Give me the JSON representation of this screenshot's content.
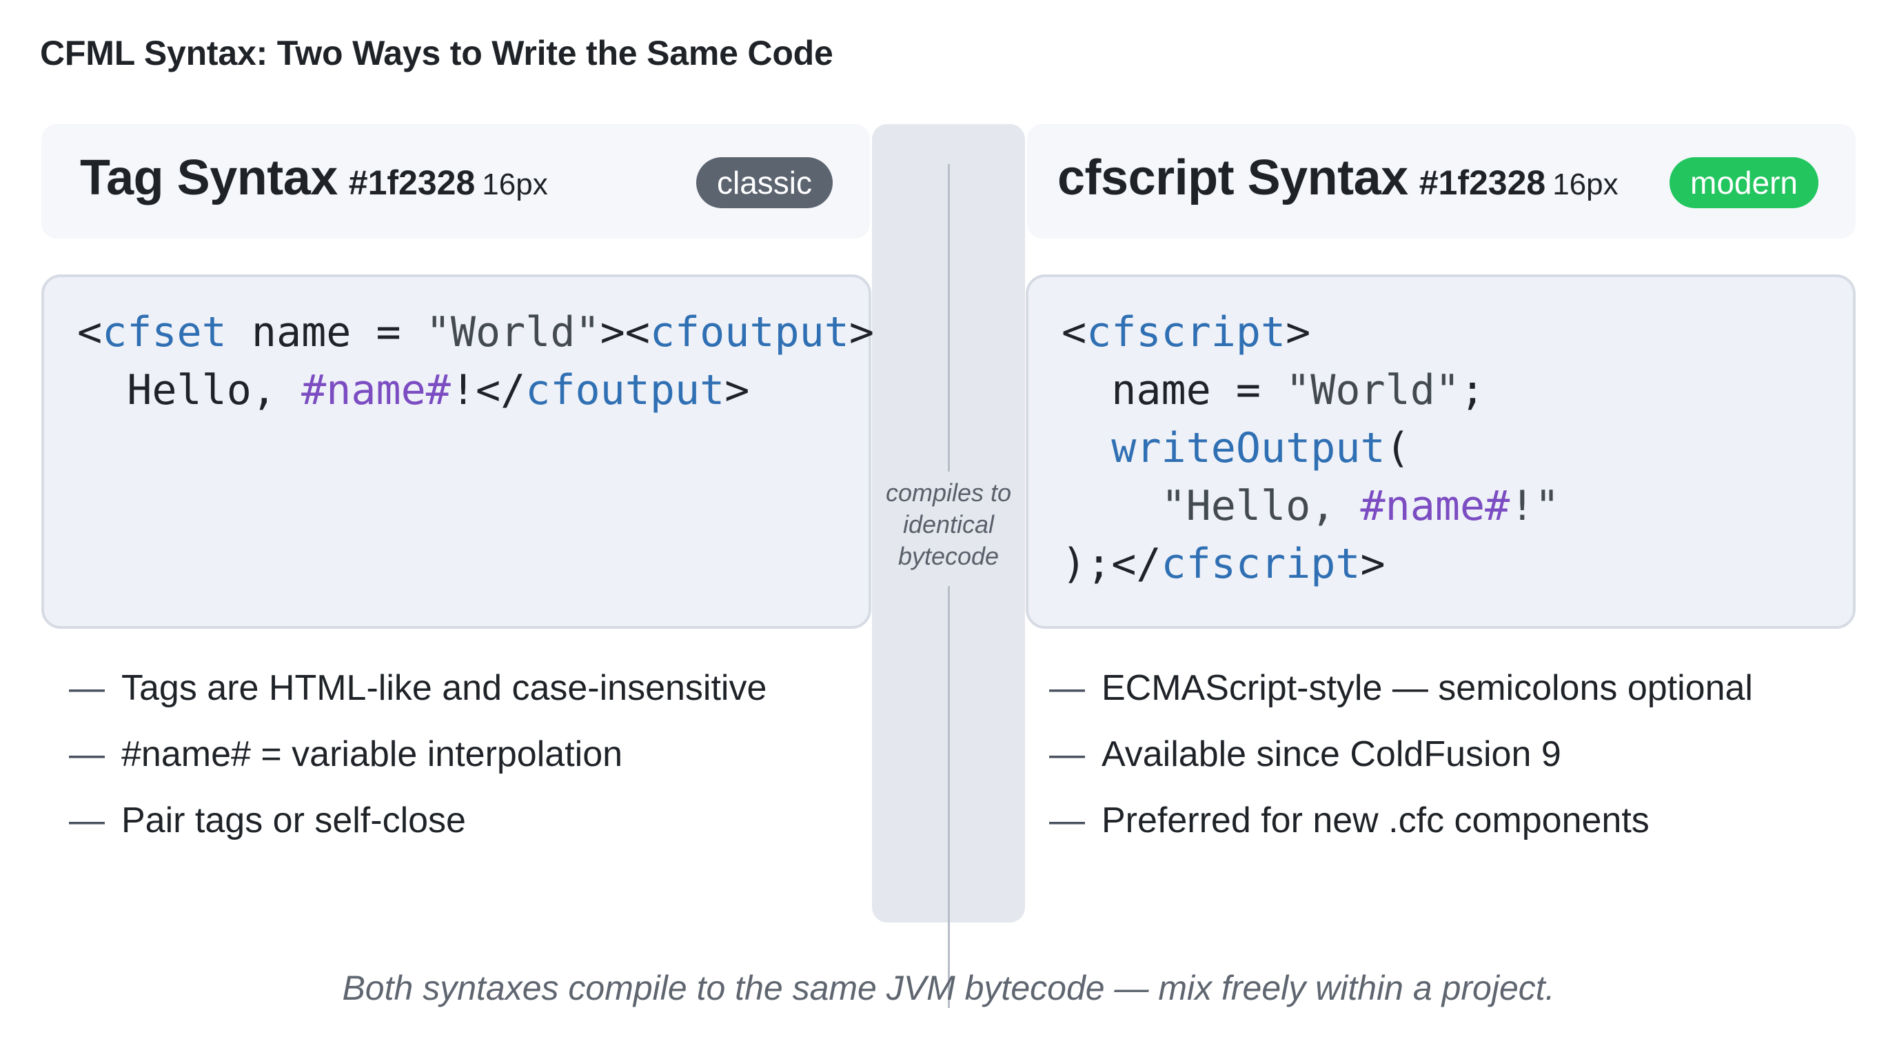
{
  "title": "CFML Syntax: Two Ways to Write the Same Code",
  "colors": {
    "text": "#1f2328",
    "classic_badge": "#5c6470",
    "modern_badge": "#22c55e",
    "code_tag": "#2f6fb3",
    "code_variable": "#7b4cc2"
  },
  "left_panel": {
    "title": "Tag Syntax",
    "hex": "#1f2328",
    "px": "16px",
    "badge": "classic",
    "code_lines": [
      [
        {
          "t": "<",
          "k": "plain"
        },
        {
          "t": "cfset",
          "k": "tag"
        },
        {
          "t": " name = ",
          "k": "plain"
        },
        {
          "t": "\"World\"",
          "k": "str"
        },
        {
          "t": "><",
          "k": "plain"
        },
        {
          "t": "cfoutput",
          "k": "tag"
        },
        {
          "t": ">",
          "k": "plain"
        }
      ],
      [
        {
          "t": "  Hello, ",
          "k": "plain"
        },
        {
          "t": "#name#",
          "k": "var"
        },
        {
          "t": "!</",
          "k": "plain"
        },
        {
          "t": "cfoutput",
          "k": "tag"
        },
        {
          "t": ">",
          "k": "plain"
        }
      ]
    ],
    "bullets": [
      "Tags are HTML-like and case-insensitive",
      "#name# = variable interpolation",
      "Pair tags or self-close"
    ]
  },
  "right_panel": {
    "title": "cfscript Syntax",
    "hex": "#1f2328",
    "px": "16px",
    "badge": "modern",
    "code_lines": [
      [
        {
          "t": "<",
          "k": "plain"
        },
        {
          "t": "cfscript",
          "k": "tag"
        },
        {
          "t": ">",
          "k": "plain"
        }
      ],
      [
        {
          "t": "  name = ",
          "k": "plain"
        },
        {
          "t": "\"World\"",
          "k": "str"
        },
        {
          "t": ";",
          "k": "plain"
        }
      ],
      [
        {
          "t": "  ",
          "k": "plain"
        },
        {
          "t": "writeOutput",
          "k": "fn"
        },
        {
          "t": "(",
          "k": "plain"
        }
      ],
      [
        {
          "t": "    \"Hello, ",
          "k": "str"
        },
        {
          "t": "#name#",
          "k": "var"
        },
        {
          "t": "!\"",
          "k": "str"
        }
      ],
      [
        {
          "t": ");</",
          "k": "plain"
        },
        {
          "t": "cfscript",
          "k": "tag"
        },
        {
          "t": ">",
          "k": "plain"
        }
      ]
    ],
    "bullets": [
      "ECMAScript-style — semicolons optional",
      "Available since ColdFusion 9",
      "Preferred for new .cfc components"
    ]
  },
  "divider_lines": [
    "compiles to",
    "identical",
    "bytecode"
  ],
  "bullet_marker": "—",
  "footer": "Both syntaxes compile to the same JVM bytecode — mix freely within a project."
}
